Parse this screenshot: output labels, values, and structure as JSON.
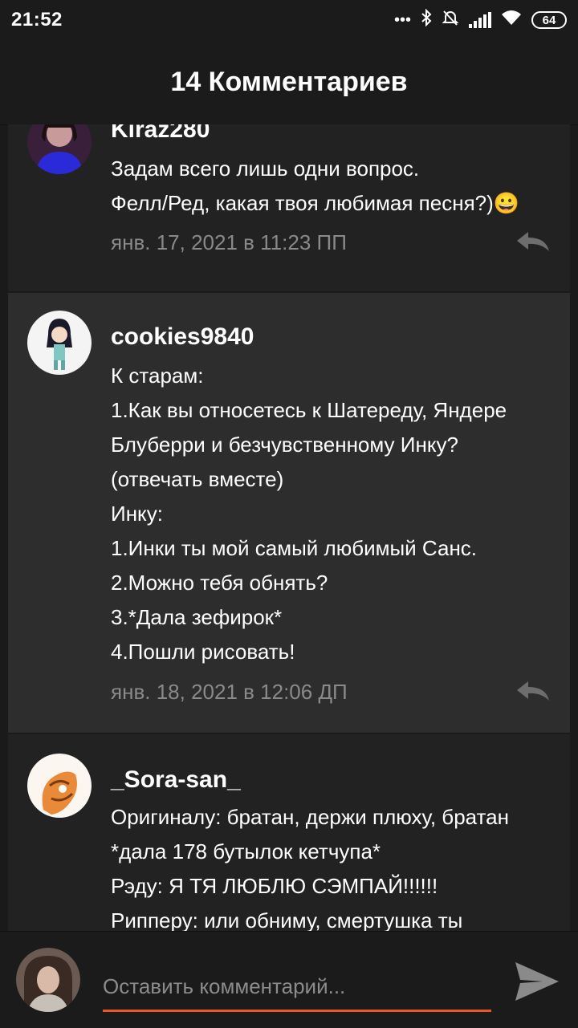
{
  "status": {
    "time": "21:52",
    "battery": "64",
    "icons": [
      "dots-icon",
      "bluetooth-icon",
      "mute-icon",
      "signal-icon",
      "wifi-icon",
      "battery-icon"
    ]
  },
  "header": {
    "title": "14 Комментариев"
  },
  "comments": [
    {
      "author": "Kiraz280",
      "lines": [
        "Задам всего лишь одни вопрос.",
        "Фелл/Ред, какая твоя любимая песня?)😀"
      ],
      "timestamp": "янв. 17, 2021 в 11:23 ПП"
    },
    {
      "author": "cookies9840",
      "lines": [
        "К старам:",
        "1.Как вы относетесь к Шатереду, Яндере",
        "Блуберри и безчувственному Инку?",
        "(отвечать вместе)",
        "Инку:",
        "1.Инки ты мой самый любимый Санс.",
        "2.Можно тебя обнять?",
        "3.*Дала зефирок*",
        "4.Пошли рисовать!"
      ],
      "timestamp": "янв. 18, 2021 в 12:06 ДП"
    },
    {
      "author": "_Sora-san_",
      "lines": [
        "Оригиналу: братан, держи плюху, братан",
        "*дала 178 бутылок кетчупа*",
        "Рэду: Я ТЯ ЛЮБЛЮ СЭМПАЙ!!!!!!",
        "Рипперу: или обниму, смертушка ты"
      ]
    }
  ],
  "composer": {
    "placeholder": "Оставить комментарий..."
  },
  "colors": {
    "accent": "#e8562a",
    "background": "#1a1a1a",
    "card": "#222222",
    "card_highlight": "#2d2d2d",
    "muted": "#8a8a8a"
  }
}
